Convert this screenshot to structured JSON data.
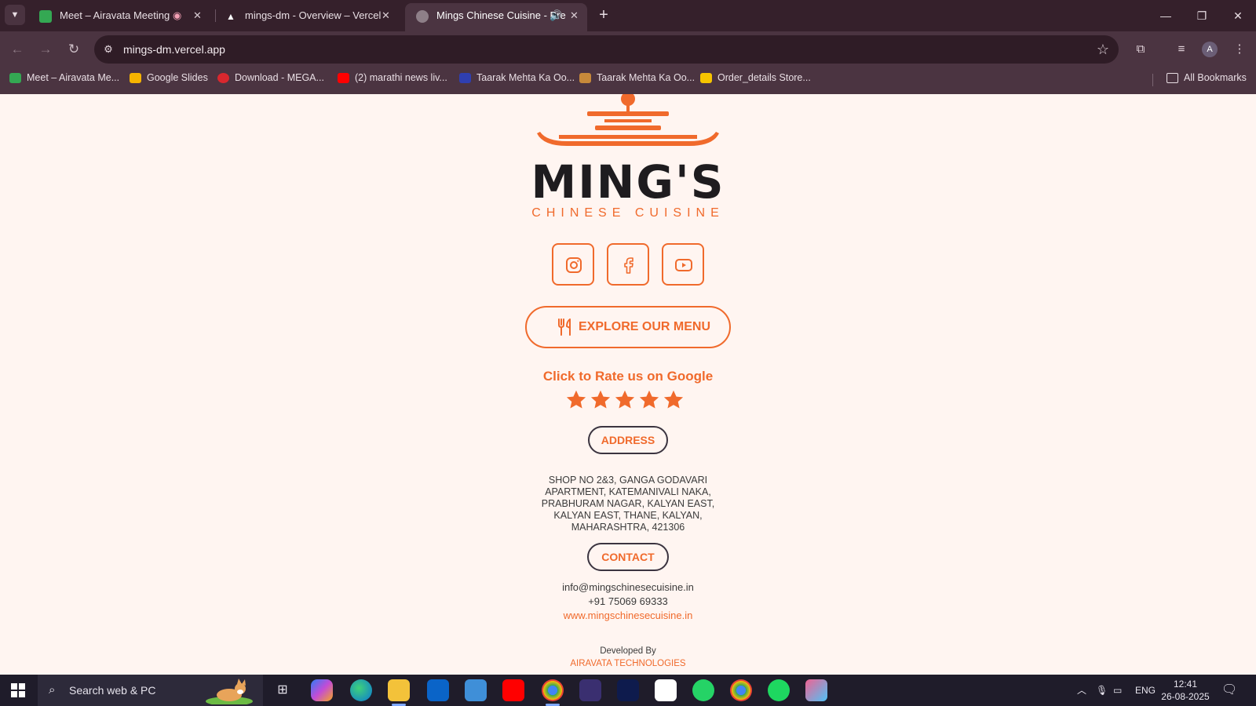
{
  "browser": {
    "tabs": [
      {
        "title": "Meet – Airavata Meeting",
        "icon": "google-meet-icon",
        "status_icon": "recording-icon"
      },
      {
        "title": "mings-dm - Overview – Vercel",
        "icon": "vercel-icon"
      },
      {
        "title": "Mings Chinese Cuisine - Pre",
        "icon": "globe-icon",
        "status_icon": "speaker-icon",
        "active": true
      }
    ],
    "url": "mings-dm.vercel.app",
    "bookmarks": [
      {
        "label": "Meet – Airavata Me...",
        "icon": "google-meet-icon",
        "color": "#34a853"
      },
      {
        "label": "Google Slides",
        "icon": "google-slides-icon",
        "color": "#f6b400"
      },
      {
        "label": "Download - MEGA...",
        "icon": "mega-icon",
        "color": "#d9272e"
      },
      {
        "label": "(2) marathi news liv...",
        "icon": "youtube-icon",
        "color": "#ff0000"
      },
      {
        "label": "Taarak Mehta Ka Oo...",
        "icon": "site-icon",
        "color": "#2f3fb0"
      },
      {
        "label": "Taarak Mehta Ka Oo...",
        "icon": "site-icon",
        "color": "#c7893a"
      },
      {
        "label": "Order_details Store...",
        "icon": "sheets-icon",
        "color": "#f6c400"
      }
    ],
    "all_bookmarks": "All Bookmarks"
  },
  "page": {
    "logo": {
      "title": "MING'S",
      "subtitle": "CHINESE CUISINE"
    },
    "social": [
      {
        "name": "instagram",
        "icon": "instagram-icon"
      },
      {
        "name": "facebook",
        "icon": "facebook-icon"
      },
      {
        "name": "youtube",
        "icon": "youtube-icon"
      }
    ],
    "explore_label": "EXPLORE OUR MENU",
    "rate_label": "Click to Rate us on Google",
    "rating_stars": 5,
    "address_label": "ADDRESS",
    "address_lines": [
      "SHOP NO 2&3, GANGA GODAVARI",
      "APARTMENT, KATEMANIVALI NAKA,",
      "PRABHURAM NAGAR, KALYAN EAST,",
      "KALYAN EAST, THANE, KALYAN,",
      "MAHARASHTRA, 421306"
    ],
    "contact_label": "CONTACT",
    "email": "info@mingschinesecuisine.in",
    "phone": "+91 75069 69333",
    "website": "www.mingschinesecuisine.in",
    "developed_by": "Developed By",
    "developer": "AIRAVATA TECHNOLOGIES",
    "accent_color": "#f06a2c"
  },
  "taskbar": {
    "search_placeholder": "Search web & PC",
    "apps": [
      "task-view",
      "copilot",
      "edge",
      "file-explorer",
      "outlook",
      "photos",
      "youtube",
      "chrome",
      "sony-liv",
      "hotstar",
      "capcut",
      "whatsapp",
      "chrome-profile",
      "spotify",
      "paint"
    ],
    "lang": "ENG",
    "time": "12:41",
    "date": "26-08-2025"
  }
}
